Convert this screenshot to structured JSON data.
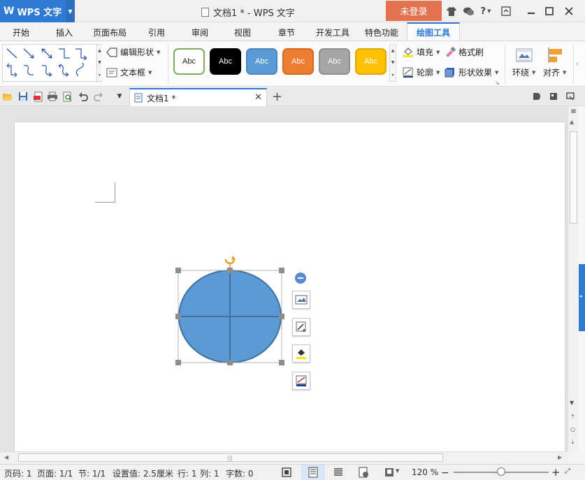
{
  "titlebar": {
    "app_name": "WPS 文字",
    "doc_title": "文档1 * - WPS 文字",
    "login": "未登录",
    "help": "?"
  },
  "tabs": [
    "开始",
    "插入",
    "页面布局",
    "引用",
    "审阅",
    "视图",
    "章节",
    "开发工具",
    "特色功能",
    "绘图工具"
  ],
  "active_tab": "绘图工具",
  "ribbon": {
    "edit_shape": "编辑形状",
    "text_box": "文本框",
    "styles": [
      {
        "label": "Abc",
        "fill": "#ffffff",
        "border": "#7cae5a",
        "text": "#222222"
      },
      {
        "label": "Abc",
        "fill": "#000000",
        "border": "#000000",
        "text": "#ffffff"
      },
      {
        "label": "Abc",
        "fill": "#5b9bd5",
        "border": "#4a85bd",
        "text": "#ffffff"
      },
      {
        "label": "Abc",
        "fill": "#ed7d31",
        "border": "#d46a20",
        "text": "#ffffff"
      },
      {
        "label": "Abc",
        "fill": "#a5a5a5",
        "border": "#8f8f8f",
        "text": "#ffffff"
      },
      {
        "label": "Abc",
        "fill": "#ffc000",
        "border": "#e0a800",
        "text": "#ffffff"
      }
    ],
    "fill": "填充",
    "format_painter": "格式刷",
    "outline": "轮廓",
    "shape_effects": "形状效果",
    "wrap": "环绕",
    "align": "对齐"
  },
  "doc_tab": {
    "title": "文档1 *"
  },
  "shape": {
    "fill": "#5b9bd5",
    "stroke": "#41719c",
    "type": "ellipse-with-cross"
  },
  "statusbar": {
    "page_no": "页码: 1",
    "pages": "页面: 1/1",
    "section": "节: 1/1",
    "setting": "设置值: 2.5厘米",
    "row": "行: 1",
    "col": "列: 1",
    "words": "字数: 0",
    "zoom": "120 %"
  },
  "colors": {
    "accent": "#2f7bd3",
    "login": "#e2714f"
  }
}
